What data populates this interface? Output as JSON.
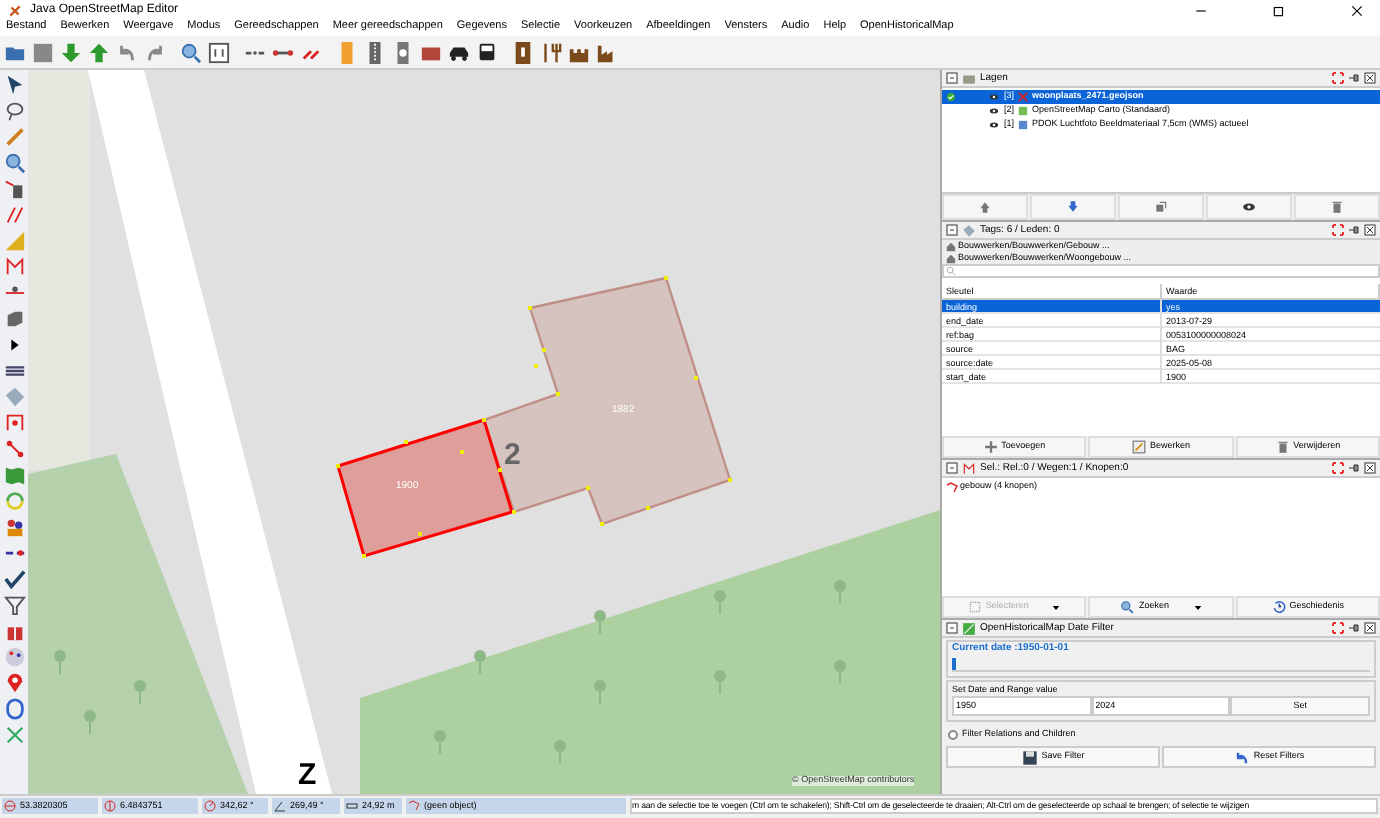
{
  "window": {
    "title": "Java OpenStreetMap Editor"
  },
  "menu": [
    "Bestand",
    "Bewerken",
    "Weergave",
    "Modus",
    "Gereedschappen",
    "Meer gereedschappen",
    "Gegevens",
    "Selectie",
    "Voorkeuzen",
    "Afbeeldingen",
    "Vensters",
    "Audio",
    "Help",
    "OpenHistoricalMap"
  ],
  "layers": {
    "title": "Lagen",
    "items": [
      {
        "index": "[3]",
        "name": "woonplaats_2471.geojson",
        "selected": true,
        "active": true
      },
      {
        "index": "[2]",
        "name": "OpenStreetMap Carto (Standaard)",
        "selected": false,
        "active": false
      },
      {
        "index": "[1]",
        "name": "PDOK Luchtfoto Beeldmateriaal 7,5cm (WMS) actueel",
        "selected": false,
        "active": false
      }
    ]
  },
  "tags": {
    "title": "Tags: 6 / Leden: 0",
    "presets": [
      "Bouwwerken/Bouwwerken/Gebouw ...",
      "Bouwwerken/Bouwwerken/Woongebouw ..."
    ],
    "columns": [
      "Sleutel",
      "Waarde"
    ],
    "rows": [
      {
        "key": "building",
        "value": "yes",
        "selected": true
      },
      {
        "key": "end_date",
        "value": "2013-07-29",
        "selected": false
      },
      {
        "key": "ref:bag",
        "value": "0053100000008024",
        "selected": false
      },
      {
        "key": "source",
        "value": "BAG",
        "selected": false
      },
      {
        "key": "source:date",
        "value": "2025-05-08",
        "selected": false
      },
      {
        "key": "start_date",
        "value": "1900",
        "selected": false
      }
    ],
    "buttons": [
      "Toevoegen",
      "Bewerken",
      "Verwijderen"
    ]
  },
  "selection": {
    "title": "Sel.: Rel.:0 / Wegen:1 / Knopen:0",
    "items": [
      "gebouw (4 knopen)"
    ],
    "buttons": [
      {
        "label": "Selecteren",
        "disabled": true,
        "dropdown": true
      },
      {
        "label": "Zoeken",
        "disabled": false,
        "dropdown": true
      },
      {
        "label": "Geschiedenis",
        "disabled": false,
        "dropdown": false
      }
    ]
  },
  "date_filter": {
    "title": "OpenHistoricalMap Date Filter",
    "current_date": "Current date :1950-01-01",
    "level": 0,
    "range_label": "Set Date and Range value",
    "start": "1950",
    "end": "2024",
    "set_button": "Set",
    "checkbox": {
      "label": "Filter Relations and Children",
      "checked": false
    },
    "buttons": [
      "Save Filter",
      "Reset Filters"
    ]
  },
  "map": {
    "buildings": [
      {
        "label": "1900",
        "selected": true
      },
      {
        "label": "1882",
        "selected": false
      }
    ],
    "house_number": "2",
    "street_label": "Z",
    "attribution": "© OpenStreetMap contributors"
  },
  "status_bar": {
    "lat": "53.3820305",
    "lon": "6.4843751",
    "heading": "342,62 °",
    "angle": "269,49 °",
    "distance": "24,92 m",
    "object": "(geen object)",
    "help": "m aan de selectie toe te voegen (Ctrl om te schakelen); Shift-Ctrl om de geselecteerde te draaien; Alt-Ctrl om de geselecteerde op schaal te brengen; of selectie te wijzigen"
  }
}
